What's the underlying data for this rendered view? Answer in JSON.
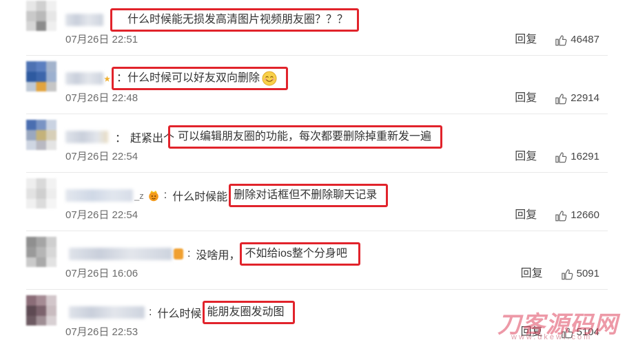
{
  "comments": [
    {
      "highlight": "什么时候能无损发高清图片视频朋友圈？？？",
      "date": "07月26日 22:51",
      "reply": "回复",
      "likes": "46487"
    },
    {
      "colon": "：",
      "highlight": "什么时候可以好友双向删除",
      "emoji": "smile-emoji",
      "date": "07月26日 22:48",
      "reply": "回复",
      "likes": "22914"
    },
    {
      "colon": "：",
      "prefix": "赶紧出个",
      "highlight": "可以编辑朋友圈的功能，每次都要删除掉重新发一遍",
      "date": "07月26日 22:54",
      "reply": "回复",
      "likes": "16291"
    },
    {
      "username_tail": "_z",
      "badge": "crown-emoji",
      "colon": ":",
      "prefix": "什么时候能",
      "highlight": "删除对话框但不删除聊天记录",
      "date": "07月26日 22:54",
      "reply": "回复",
      "likes": "12660"
    },
    {
      "badge": "orange-emoji",
      "colon": ":",
      "prefix": "没啥用，",
      "highlight": "不如给ios整个分身吧",
      "date": "07月26日 16:06",
      "reply": "回复",
      "likes": "5091"
    },
    {
      "colon": ":",
      "prefix": "什么时候",
      "highlight": "能朋友圈发动图",
      "date": "07月26日 22:53",
      "reply": "回复",
      "likes": "5104"
    }
  ],
  "watermark": {
    "name": "刀客源码网",
    "url": "www.dkewl.com"
  },
  "colors": {
    "highlight_border": "#e1232b",
    "watermark": "#de465f",
    "divider": "#e9e9e9"
  },
  "icons": {
    "like": "thumbs-up-icon",
    "avatar": "blurred-avatar"
  }
}
